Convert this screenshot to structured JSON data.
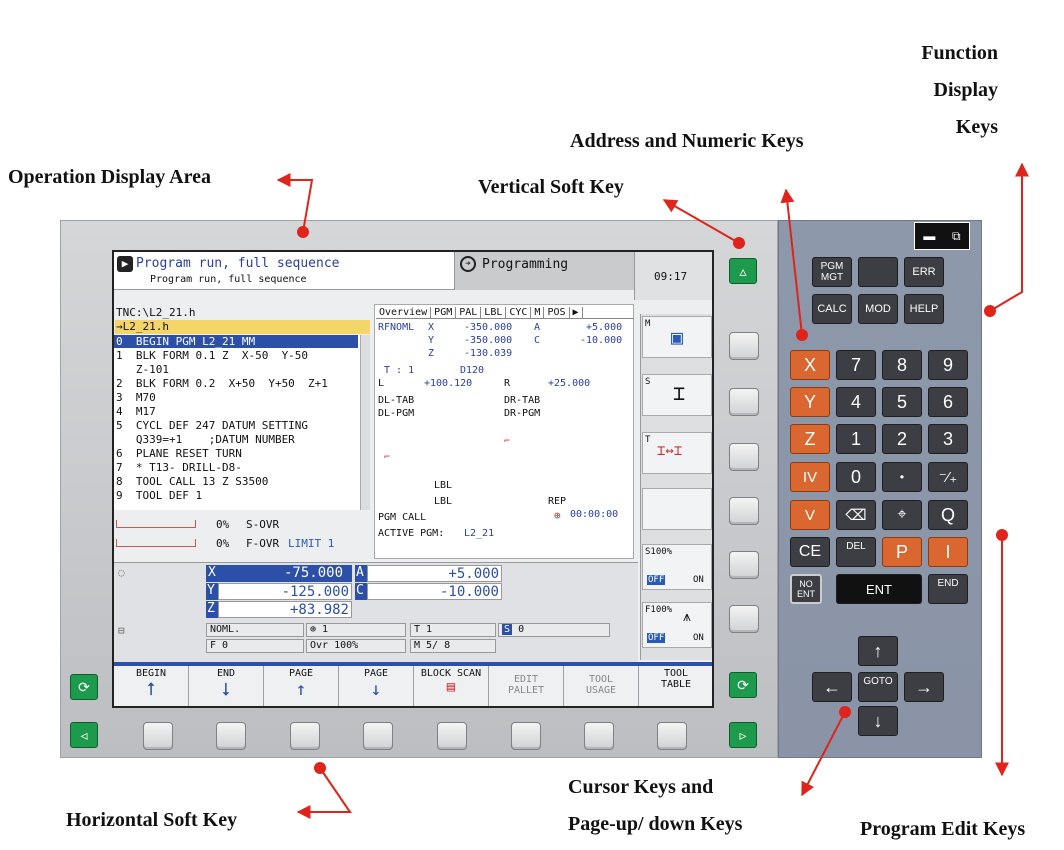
{
  "labels": {
    "operation_display_area": "Operation Display Area",
    "vertical_soft_key": "Vertical Soft Key",
    "address_numeric_keys": "Address and Numeric Keys",
    "function_display_keys": [
      "Function",
      "Display",
      "Keys"
    ],
    "horizontal_soft_key": "Horizontal Soft Key",
    "cursor_keys": [
      "Cursor Keys and",
      "Page-up/ down Keys"
    ],
    "program_edit_keys": "Program Edit Keys"
  },
  "screen": {
    "mode_title": "Program run, full sequence",
    "mode_subtitle": "Program run, full sequence",
    "programming": "Programming",
    "clock": "09:17",
    "path": "TNC:\\L2_21.h",
    "file": "→L2_21.h",
    "program": [
      "0  BEGIN PGM L2_21 MM",
      "1  BLK FORM 0.1 Z  X-50  Y-50",
      "   Z-101",
      "2  BLK FORM 0.2  X+50  Y+50  Z+1",
      "3  M70",
      "4  M17",
      "5  CYCL DEF 247 DATUM SETTING",
      "   Q339=+1    ;DATUM NUMBER",
      "6  PLANE RESET TURN",
      "7  * T13- DRILL-D8-",
      "8  TOOL CALL 13 Z S3500",
      "9  TOOL DEF 1"
    ],
    "tabs": [
      "Overview",
      "PGM",
      "PAL",
      "LBL",
      "CYC",
      "M",
      "POS"
    ],
    "rfnoml": "RFNOML",
    "ov_x": "X",
    "ov_x_val": "-350.000",
    "ov_a": "A",
    "ov_a_val": "+5.000",
    "ov_y": "Y",
    "ov_y_val": "-350.000",
    "ov_c": "C",
    "ov_c_val": "-10.000",
    "ov_z": "Z",
    "ov_z_val": "-130.039",
    "tool": "T : 1",
    "tool_name": "D120",
    "l_label": "L",
    "l_val": "+100.120",
    "r_label": "R",
    "r_val": "+25.000",
    "dl_tab": "DL-TAB",
    "dr_tab": "DR-TAB",
    "dl_pgm": "DL-PGM",
    "dr_pgm": "DR-PGM",
    "lbl1": "LBL",
    "lbl2": "LBL",
    "rep": "REP",
    "timer": "00:00:00",
    "pgm_call": "PGM CALL",
    "active_pgm": "ACTIVE PGM:",
    "active_pgm_val": "L2_21",
    "s_ovr_pct": "0%",
    "s_ovr": "S-OVR",
    "f_ovr_pct": "0%",
    "f_ovr": "F-OVR",
    "f_limit": "LIMIT 1",
    "pos": [
      {
        "axis": "X",
        "value": "-75.000",
        "axis2": "A",
        "value2": "+5.000"
      },
      {
        "axis": "Y",
        "value": "-125.000",
        "axis2": "C",
        "value2": "-10.000"
      },
      {
        "axis": "Z",
        "value": "+83.982"
      }
    ],
    "noml": "NOML.",
    "count1": "1",
    "t1": "T 1",
    "s_label": "S",
    "s_val": "0",
    "f0": "F 0",
    "ovr": "Ovr  100%",
    "m58": "M 5/ 8",
    "side_m": "M",
    "side_s": "S",
    "side_t": "T",
    "s100": "S100%",
    "f100": "F100%",
    "off1": "OFF",
    "on1": "ON",
    "off2": "OFF",
    "on2": "ON",
    "softkeys": [
      "BEGIN",
      "END",
      "PAGE",
      "PAGE",
      "BLOCK SCAN",
      "EDIT PALLET",
      "TOOL USAGE",
      "TOOL TABLE"
    ]
  },
  "keys": {
    "pgm_mgt": "PGM MGT",
    "err": "ERR",
    "calc": "CALC",
    "mod": "MOD",
    "help": "HELP",
    "x": "X",
    "y": "Y",
    "z": "Z",
    "iv": "IV",
    "v": "V",
    "n7": "7",
    "n8": "8",
    "n9": "9",
    "n4": "4",
    "n5": "5",
    "n6": "6",
    "n1": "1",
    "n2": "2",
    "n3": "3",
    "n0": "0",
    "dot": "•",
    "sign": "⁻⁄₊",
    "q": "Q",
    "ce": "CE",
    "del": "DEL",
    "p": "P",
    "i": "I",
    "no_ent": "NO ENT",
    "ent": "ENT",
    "end": "END",
    "goto": "GOTO"
  }
}
